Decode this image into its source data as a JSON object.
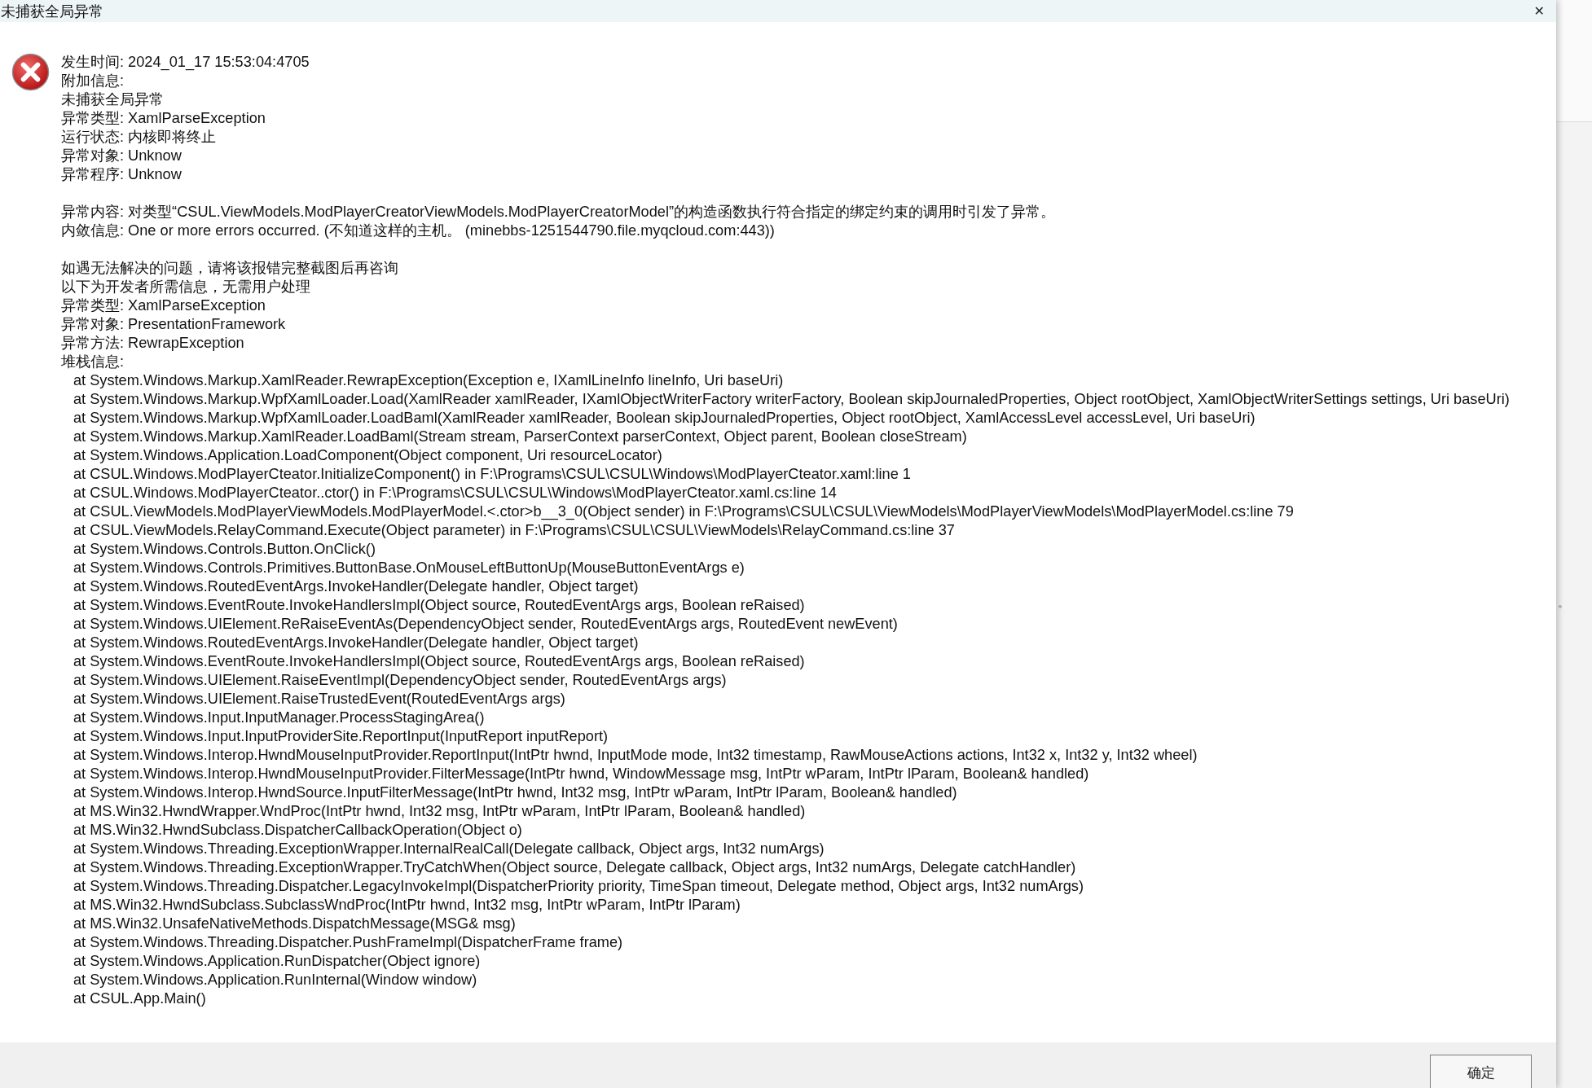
{
  "window": {
    "title": "未捕获全局异常",
    "close": "✕"
  },
  "summary": [
    "发生时间: 2024_01_17 15:53:04:4705",
    "附加信息:",
    "未捕获全局异常",
    "异常类型: XamlParseException",
    "运行状态: 内核即将终止",
    "异常对象: Unknow",
    "异常程序: Unknow"
  ],
  "details": [
    "异常内容: 对类型“CSUL.ViewModels.ModPlayerCreatorViewModels.ModPlayerCreatorModel”的构造函数执行符合指定的绑定约束的调用时引发了异常。",
    "内敛信息: One or more errors occurred. (不知道这样的主机。 (minebbs-1251544790.file.myqcloud.com:443))"
  ],
  "developer": [
    "如遇无法解决的问题，请将该报错完整截图后再咨询",
    "以下为开发者所需信息，无需用户处理",
    "异常类型: XamlParseException",
    "异常对象: PresentationFramework",
    "异常方法: RewrapException",
    "堆栈信息:"
  ],
  "stack_trace": [
    "at System.Windows.Markup.XamlReader.RewrapException(Exception e, IXamlLineInfo lineInfo, Uri baseUri)",
    "at System.Windows.Markup.WpfXamlLoader.Load(XamlReader xamlReader, IXamlObjectWriterFactory writerFactory, Boolean skipJournaledProperties, Object rootObject, XamlObjectWriterSettings settings, Uri baseUri)",
    "at System.Windows.Markup.WpfXamlLoader.LoadBaml(XamlReader xamlReader, Boolean skipJournaledProperties, Object rootObject, XamlAccessLevel accessLevel, Uri baseUri)",
    "at System.Windows.Markup.XamlReader.LoadBaml(Stream stream, ParserContext parserContext, Object parent, Boolean closeStream)",
    "at System.Windows.Application.LoadComponent(Object component, Uri resourceLocator)",
    "at CSUL.Windows.ModPlayerCteator.InitializeComponent() in F:\\Programs\\CSUL\\CSUL\\Windows\\ModPlayerCteator.xaml:line 1",
    "at CSUL.Windows.ModPlayerCteator..ctor() in F:\\Programs\\CSUL\\CSUL\\Windows\\ModPlayerCteator.xaml.cs:line 14",
    "at CSUL.ViewModels.ModPlayerViewModels.ModPlayerModel.<.ctor>b__3_0(Object sender) in F:\\Programs\\CSUL\\CSUL\\ViewModels\\ModPlayerViewModels\\ModPlayerModel.cs:line 79",
    "at CSUL.ViewModels.RelayCommand.Execute(Object parameter) in F:\\Programs\\CSUL\\CSUL\\ViewModels\\RelayCommand.cs:line 37",
    "at System.Windows.Controls.Button.OnClick()",
    "at System.Windows.Controls.Primitives.ButtonBase.OnMouseLeftButtonUp(MouseButtonEventArgs e)",
    "at System.Windows.RoutedEventArgs.InvokeHandler(Delegate handler, Object target)",
    "at System.Windows.EventRoute.InvokeHandlersImpl(Object source, RoutedEventArgs args, Boolean reRaised)",
    "at System.Windows.UIElement.ReRaiseEventAs(DependencyObject sender, RoutedEventArgs args, RoutedEvent newEvent)",
    "at System.Windows.RoutedEventArgs.InvokeHandler(Delegate handler, Object target)",
    "at System.Windows.EventRoute.InvokeHandlersImpl(Object source, RoutedEventArgs args, Boolean reRaised)",
    "at System.Windows.UIElement.RaiseEventImpl(DependencyObject sender, RoutedEventArgs args)",
    "at System.Windows.UIElement.RaiseTrustedEvent(RoutedEventArgs args)",
    "at System.Windows.Input.InputManager.ProcessStagingArea()",
    "at System.Windows.Input.InputProviderSite.ReportInput(InputReport inputReport)",
    "at System.Windows.Interop.HwndMouseInputProvider.ReportInput(IntPtr hwnd, InputMode mode, Int32 timestamp, RawMouseActions actions, Int32 x, Int32 y, Int32 wheel)",
    "at System.Windows.Interop.HwndMouseInputProvider.FilterMessage(IntPtr hwnd, WindowMessage msg, IntPtr wParam, IntPtr lParam, Boolean& handled)",
    "at System.Windows.Interop.HwndSource.InputFilterMessage(IntPtr hwnd, Int32 msg, IntPtr wParam, IntPtr lParam, Boolean& handled)",
    "at MS.Win32.HwndWrapper.WndProc(IntPtr hwnd, Int32 msg, IntPtr wParam, IntPtr lParam, Boolean& handled)",
    "at MS.Win32.HwndSubclass.DispatcherCallbackOperation(Object o)",
    "at System.Windows.Threading.ExceptionWrapper.InternalRealCall(Delegate callback, Object args, Int32 numArgs)",
    "at System.Windows.Threading.ExceptionWrapper.TryCatchWhen(Object source, Delegate callback, Object args, Int32 numArgs, Delegate catchHandler)",
    "at System.Windows.Threading.Dispatcher.LegacyInvokeImpl(DispatcherPriority priority, TimeSpan timeout, Delegate method, Object args, Int32 numArgs)",
    "at MS.Win32.HwndSubclass.SubclassWndProc(IntPtr hwnd, Int32 msg, IntPtr wParam, IntPtr lParam)",
    "at MS.Win32.UnsafeNativeMethods.DispatchMessage(MSG& msg)",
    "at System.Windows.Threading.Dispatcher.PushFrameImpl(DispatcherFrame frame)",
    "at System.Windows.Application.RunDispatcher(Object ignore)",
    "at System.Windows.Application.RunInternal(Window window)",
    "at CSUL.App.Main()"
  ],
  "buttons": [
    "确定"
  ],
  "background_window": {
    "text": "。"
  }
}
